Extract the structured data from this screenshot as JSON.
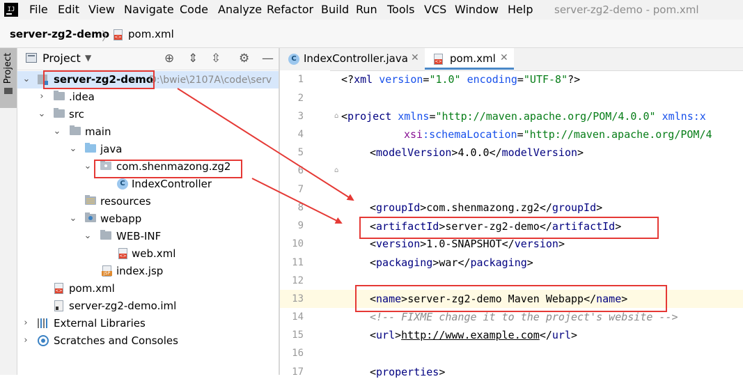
{
  "app": {
    "menu": [
      "File",
      "Edit",
      "View",
      "Navigate",
      "Code",
      "Analyze",
      "Refactor",
      "Build",
      "Run",
      "Tools",
      "VCS",
      "Window",
      "Help"
    ],
    "window_title": "server-zg2-demo - pom.xml"
  },
  "navbar": {
    "project": "server-zg2-demo",
    "file": "pom.xml",
    "separator": "〉"
  },
  "stripe": {
    "project_label": "Project"
  },
  "panel": {
    "title": "Project",
    "dropdown_icon": "chevron-down-icon"
  },
  "tree": {
    "root_name": "server-zg2-demo",
    "root_path": "D:\\bwie\\2107A\\code\\serv",
    "idea": ".idea",
    "src": "src",
    "main": "main",
    "java": "java",
    "package": "com.shenmazong.zg2",
    "controller": "IndexController",
    "resources": "resources",
    "webapp": "webapp",
    "webinf": "WEB-INF",
    "webxml": "web.xml",
    "indexjsp": "index.jsp",
    "pomxml": "pom.xml",
    "iml": "server-zg2-demo.iml",
    "ext_libs": "External Libraries",
    "scratches": "Scratches and Consoles"
  },
  "tabs": [
    {
      "label": "IndexController.java"
    },
    {
      "label": "pom.xml"
    }
  ],
  "editor": {
    "line_numbers": [
      "1",
      "2",
      "3",
      "4",
      "5",
      "6",
      "7",
      "8",
      "9",
      "10",
      "11",
      "12",
      "13",
      "14",
      "15",
      "16",
      "17"
    ],
    "line1": {
      "open": "<?",
      "tag": "xml",
      "attr1": "version",
      "eq1": "=",
      "val1": "\"1.0\"",
      "attr2": "encoding",
      "eq2": "=",
      "val2": "\"UTF-8\"",
      "close": "?>"
    },
    "line3": {
      "open": "<",
      "tag": "project",
      "attr": "xmlns",
      "eq": "=",
      "val": "\"http://maven.apache.org/POM/4.0.0\"",
      "attr2": "xmlns:x"
    },
    "line4": {
      "ns": "xsi",
      "attr": ":schemaLocation",
      "eq": "=",
      "val": "\"http://maven.apache.org/POM/4"
    },
    "line5": {
      "tag": "modelVersion",
      "text": "4.0.0"
    },
    "line8": {
      "tag": "groupId",
      "text": "com.shenmazong.zg2"
    },
    "line9": {
      "tag": "artifactId",
      "text": "server-zg2-demo"
    },
    "line10": {
      "tag": "version",
      "text": "1.0-SNAPSHOT"
    },
    "line11": {
      "tag": "packaging",
      "text": "war"
    },
    "line13": {
      "tag": "name",
      "text": "server-zg2-demo Maven Webapp"
    },
    "line14": {
      "comment": "<!-- FIXME change it to the project's website -->"
    },
    "line15": {
      "tag": "url",
      "text": "http://www.example.com"
    },
    "line17": {
      "tag": "properties"
    }
  },
  "colors": {
    "annotation": "#e53935",
    "selection": "#d7e7fb",
    "current_line": "#fffae3",
    "tab_accent": "#4a88c7"
  }
}
